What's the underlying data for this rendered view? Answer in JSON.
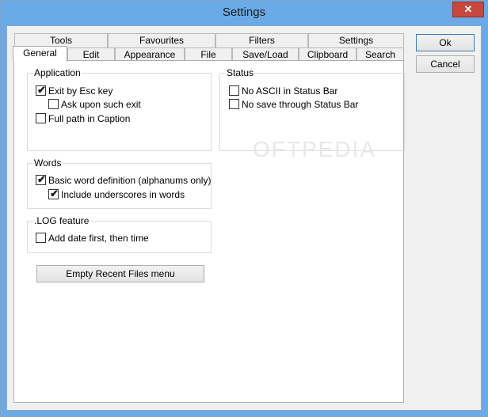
{
  "window": {
    "title": "Settings",
    "close_symbol": "✕"
  },
  "tabs": {
    "row_top": [
      "Tools",
      "Favourites",
      "Filters",
      "Settings"
    ],
    "row_bottom": [
      "General",
      "Edit",
      "Appearance",
      "File",
      "Save/Load",
      "Clipboard",
      "Search"
    ],
    "active": "General"
  },
  "groups": {
    "application": {
      "title": "Application",
      "items": [
        {
          "label": "Exit by Esc key",
          "checked": true
        },
        {
          "label": "Ask upon such exit",
          "checked": false
        },
        {
          "label": "Full path in Caption",
          "checked": false
        }
      ]
    },
    "status": {
      "title": "Status",
      "items": [
        {
          "label": "No ASCII in Status Bar",
          "checked": false
        },
        {
          "label": "No save through Status Bar",
          "checked": false
        }
      ]
    },
    "words": {
      "title": "Words",
      "items": [
        {
          "label": "Basic word definition (alphanums only)",
          "checked": true
        },
        {
          "label": "Include underscores in words",
          "checked": true
        }
      ]
    },
    "log": {
      "title": ".LOG feature",
      "items": [
        {
          "label": "Add date first, then time",
          "checked": false
        }
      ]
    }
  },
  "buttons": {
    "ok": "Ok",
    "cancel": "Cancel",
    "empty_recent": "Empty Recent Files menu"
  },
  "check_glyph": "✔"
}
